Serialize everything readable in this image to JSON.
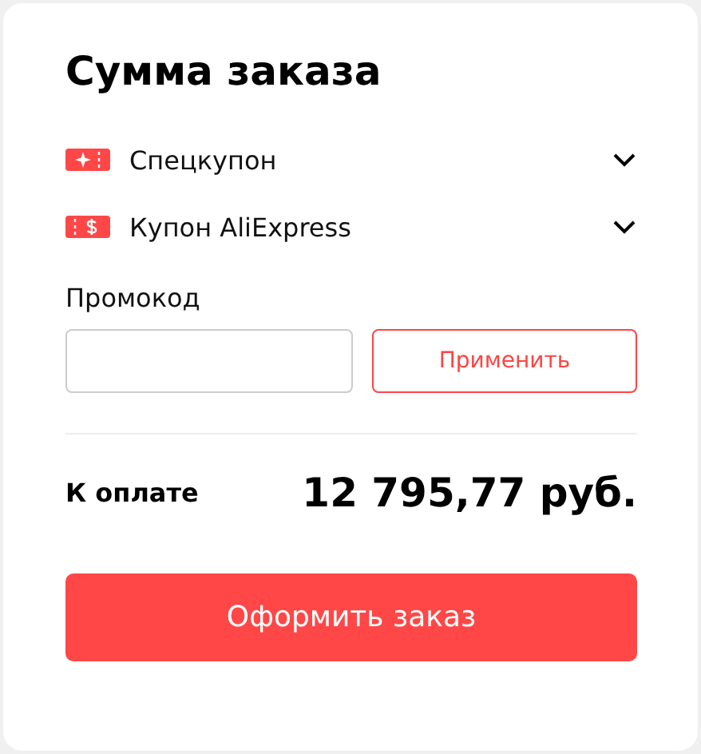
{
  "title": "Сумма заказа",
  "coupons": [
    {
      "kind": "special",
      "label": "Спецкупон",
      "expanded": false
    },
    {
      "kind": "dollar",
      "label": "Купон AliExpress",
      "expanded": false
    }
  ],
  "promo": {
    "label": "Промокод",
    "apply_button": "Применить"
  },
  "total": {
    "label": "К оплате",
    "amount": "12 795,77 руб."
  },
  "checkout_button": "Оформить заказ"
}
